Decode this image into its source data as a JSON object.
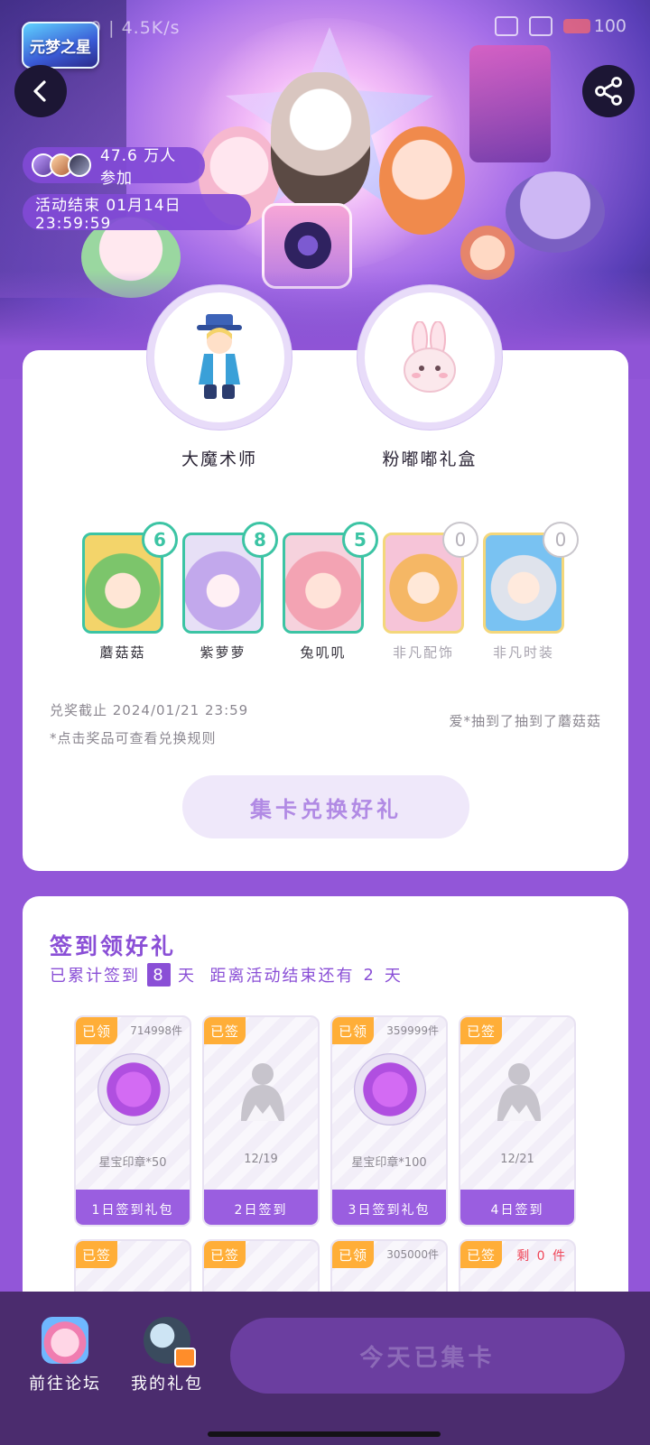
{
  "status_bar": {
    "left_text": "9 | 4.5K/s",
    "battery": "100"
  },
  "header": {
    "logo_text": "元梦之星"
  },
  "banner": {
    "participants": "47.6 万人参加",
    "end_time": "活动结束 01月14日 23:59:59"
  },
  "prizes": [
    {
      "name": "大魔术师"
    },
    {
      "name": "粉嘟嘟礼盒"
    }
  ],
  "characters": [
    {
      "name": "蘑菇菇",
      "count": "6"
    },
    {
      "name": "紫萝萝",
      "count": "8"
    },
    {
      "name": "兔叽叽",
      "count": "5"
    },
    {
      "name": "非凡配饰",
      "count": "0"
    },
    {
      "name": "非凡时装",
      "count": "0"
    }
  ],
  "redeem": {
    "deadline": "兑奖截止 2024/01/21 23:59",
    "hint": "*点击奖品可查看兑换规则",
    "lucky": "爱*抽到了抽到了蘑菇菇",
    "button": "集卡兑换好礼"
  },
  "sign_in": {
    "title": "签到领好礼",
    "sub_prefix": "已累计签到",
    "days": "8",
    "sub_mid": "天  距离活动结束还有",
    "remain": "2",
    "sub_suffix": "天",
    "slots": [
      {
        "tag": "已领",
        "count": "714998件",
        "label": "星宝印章*50",
        "bar": "1日签到礼包"
      },
      {
        "tag": "已签",
        "count": "",
        "label": "12/19",
        "bar": "2日签到"
      },
      {
        "tag": "已领",
        "count": "359999件",
        "label": "星宝印章*100",
        "bar": "3日签到礼包"
      },
      {
        "tag": "已签",
        "count": "",
        "label": "12/21",
        "bar": "4日签到"
      },
      {
        "tag": "已签",
        "count": ""
      },
      {
        "tag": "已签",
        "count": ""
      },
      {
        "tag": "已领",
        "count": "305000件"
      },
      {
        "tag": "已签",
        "count": "剩 0 件"
      }
    ]
  },
  "bottom_nav": {
    "forum": "前往论坛",
    "gift": "我的礼包",
    "today_button": "今天已集卡"
  }
}
